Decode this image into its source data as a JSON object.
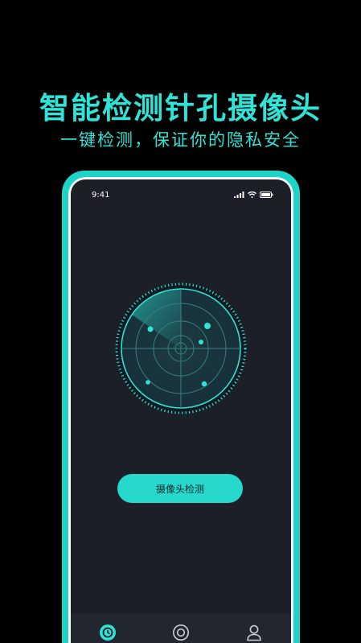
{
  "promo": {
    "headline": "智能检测针孔摄像头",
    "subline": "一键检测，保证你的隐私安全"
  },
  "status_bar": {
    "time": "9:41",
    "icons": [
      "signal-icon",
      "wifi-icon",
      "battery-icon"
    ]
  },
  "main": {
    "scan_button_label": "摄像头检测"
  },
  "tabbar": {
    "items": [
      {
        "icon": "scan-timer-icon",
        "active": true
      },
      {
        "icon": "lens-icon",
        "active": false
      },
      {
        "icon": "profile-icon",
        "active": false
      }
    ]
  },
  "colors": {
    "accent": "#2FE3D6",
    "frame": "#1ED3C7",
    "screen_bg": "#1C1F27",
    "tabbar_bg": "#22262F"
  }
}
